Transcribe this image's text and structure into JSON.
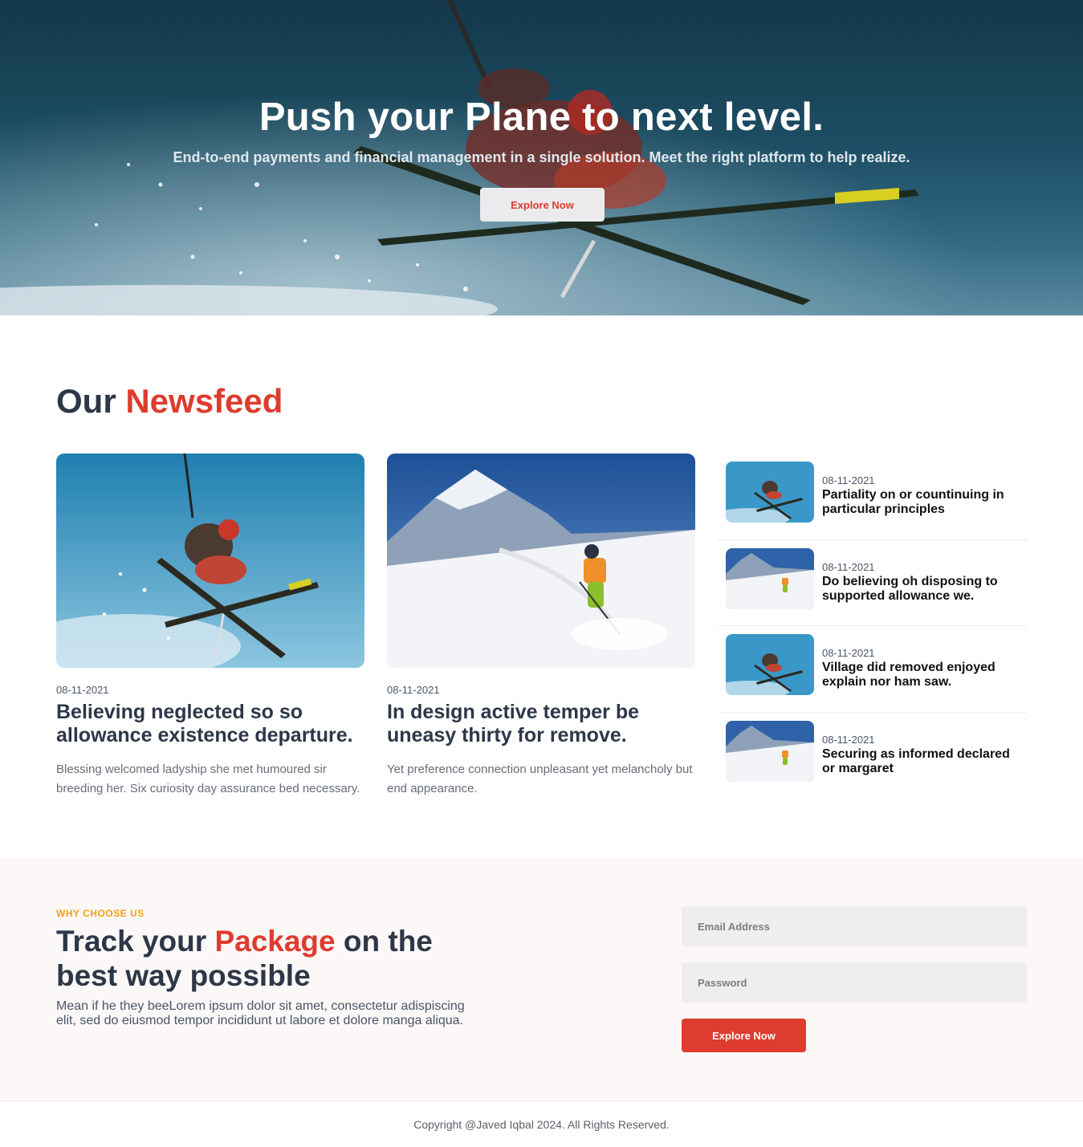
{
  "hero": {
    "title": "Push your Plane to next level.",
    "subtitle": "End-to-end payments and financial management in a single solution. Meet the right platform to help realize.",
    "button_label": "Explore Now",
    "image_icon": "skier-jump-photo"
  },
  "newsfeed": {
    "title_prefix": "Our",
    "title_accent": "Newsfeed",
    "cards": [
      {
        "date": "08-11-2021",
        "title": "Believing neglected so so allowance existence departure.",
        "text": "Blessing welcomed ladyship she met humoured sir breeding her. Six curiosity day assurance bed necessary.",
        "image_icon": "skier-jump-photo"
      },
      {
        "date": "08-11-2021",
        "title": "In design active temper be uneasy thirty for remove.",
        "text": "Yet preference connection unpleasant yet melancholy but end appearance.",
        "image_icon": "mountain-skier-photo"
      }
    ],
    "side_items": [
      {
        "date": "08-11-2021",
        "title": "Partiality on or countinuing in particular principles",
        "image_icon": "skier-jump-photo"
      },
      {
        "date": "08-11-2021",
        "title": "Do believing oh disposing to supported allowance we.",
        "image_icon": "mountain-skier-photo"
      },
      {
        "date": "08-11-2021",
        "title": "Village did removed enjoyed explain nor ham saw.",
        "image_icon": "skier-jump-photo"
      },
      {
        "date": "08-11-2021",
        "title": "Securing as informed declared or margaret",
        "image_icon": "mountain-skier-photo"
      }
    ]
  },
  "why": {
    "eyebrow": "WHY CHOOSE US",
    "title_part1": "Track your",
    "title_accent": "Package",
    "title_part2": "on the best way possible",
    "text": "Mean if he they beeLorem ipsum dolor sit amet, consectetur adispiscing elit, sed do eiusmod tempor incididunt ut labore et dolore manga aliqua.",
    "email_placeholder": "Email Address",
    "password_placeholder": "Password",
    "button_label": "Explore Now"
  },
  "footer": {
    "copyright": "Copyright @Javed Iqbal 2024. All Rights Reserved."
  },
  "colors": {
    "accent": "#dd3c2e",
    "eyebrow": "#f4a20c",
    "heading": "#2d3748"
  }
}
